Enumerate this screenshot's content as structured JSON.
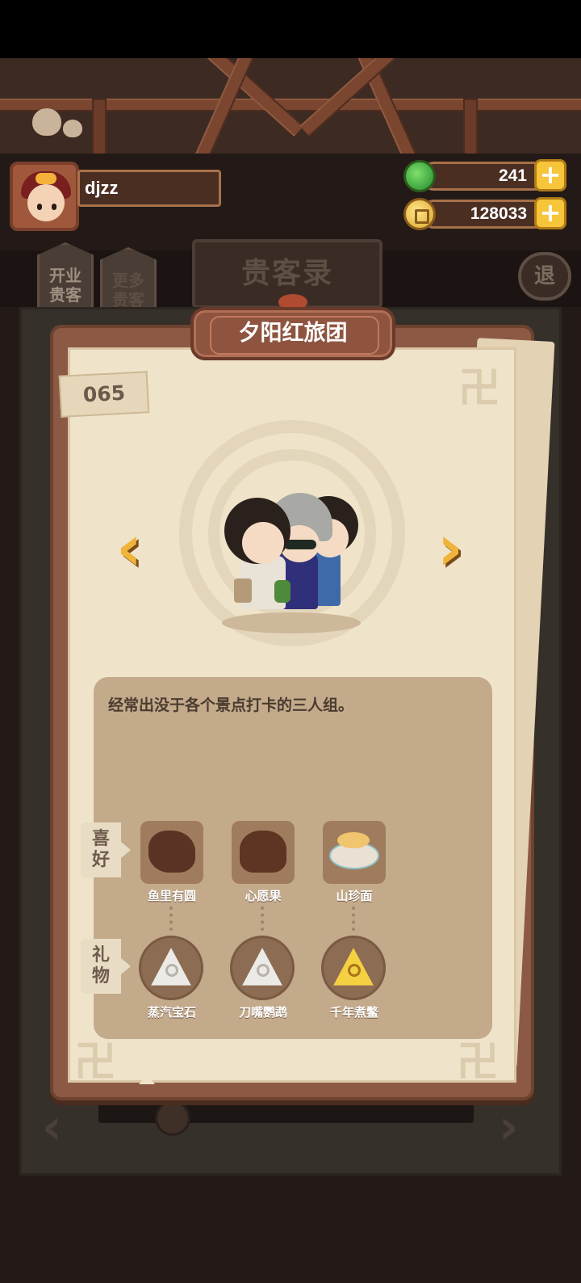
{
  "header": {
    "player_name": "djzz",
    "gems": "241",
    "coins": "128033",
    "add_symbol": "+"
  },
  "tabs": {
    "tab1": "开业\n贵客",
    "tab2": "更多\n贵客"
  },
  "book": {
    "title": "贵客录",
    "exit": "退"
  },
  "guest": {
    "name": "夕阳红旅团",
    "number": "065",
    "description": "经常出没于各个景点打卡的三人组。"
  },
  "preferences": {
    "label": "喜\n好",
    "items": [
      {
        "name": "鱼里有圆",
        "icon": "fish-dish-icon"
      },
      {
        "name": "心愿果",
        "icon": "wish-fruit-icon"
      },
      {
        "name": "山珍面",
        "icon": "noodle-set-icon"
      }
    ]
  },
  "gifts": {
    "label": "礼\n物",
    "items": [
      {
        "name": "蒸汽宝石",
        "icon": "steam-gem-icon"
      },
      {
        "name": "刀嘴鹦鹉",
        "icon": "parrot-gem-icon"
      },
      {
        "name": "千年煮鳖",
        "icon": "turtle-gem-icon"
      }
    ]
  },
  "nav": {
    "prev": "‹",
    "next": "›"
  },
  "colors": {
    "accent_gold": "#f0b43a",
    "frame_brown": "#8c5a44",
    "paper": "#efe3ca"
  }
}
